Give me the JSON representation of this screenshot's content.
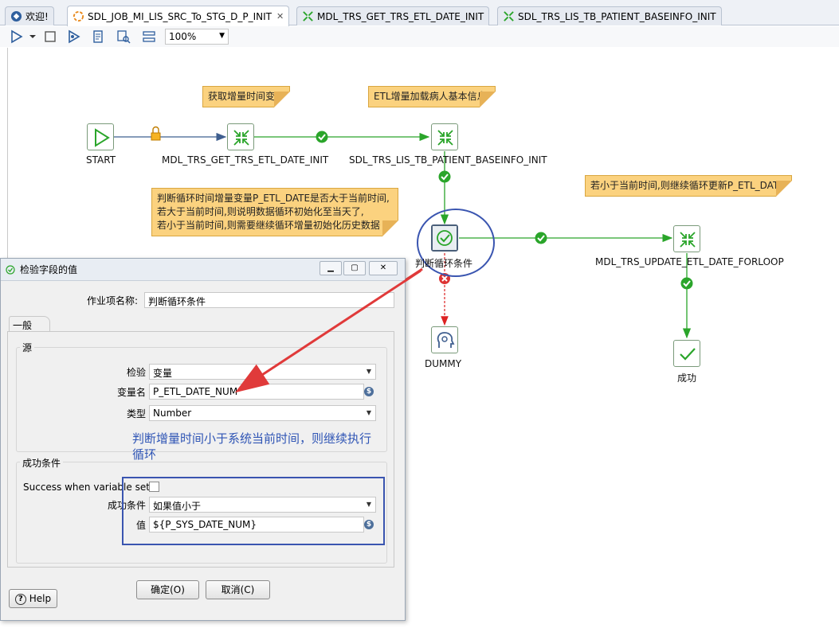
{
  "tabs": [
    {
      "label": "欢迎!",
      "icon": "welcome-icon"
    },
    {
      "label": "SDL_JOB_MI_LIS_SRC_To_STG_D_P_INIT",
      "icon": "job-icon",
      "active": true
    },
    {
      "label": "MDL_TRS_GET_TRS_ETL_DATE_INIT",
      "icon": "transformation-icon"
    },
    {
      "label": "SDL_TRS_LIS_TB_PATIENT_BASEINFO_INIT",
      "icon": "transformation-icon"
    }
  ],
  "toolbar": {
    "zoom": "100%"
  },
  "canvas": {
    "nodes": {
      "start": "START",
      "get_date": "MDL_TRS_GET_TRS_ETL_DATE_INIT",
      "patient": "SDL_TRS_LIS_TB_PATIENT_BASEINFO_INIT",
      "check": "判断循环条件",
      "update": "MDL_TRS_UPDATE_ETL_DATE_FORLOOP",
      "dummy": "DUMMY",
      "success": "成功"
    },
    "notes": {
      "get_date": "获取增量时间变量",
      "patient": "ETL增量加载病人基本信息",
      "check_lines": [
        "判断循环时间增量变量P_ETL_DATE是否大于当前时间,",
        "若大于当前时间,则说明数据循环初始化至当天了,",
        "若小于当前时间,则需要继续循环增量初始化历史数据"
      ],
      "loop": "若小于当前时间,则继续循环更新P_ETL_DATE"
    },
    "annotation_lines": [
      "判断增量时间小于系统当前时间，则继续执行",
      "循环"
    ]
  },
  "dialog": {
    "title": "检验字段的值",
    "job_name_label": "作业项名称:",
    "job_name_value": "判断循环条件",
    "tab_general": "一般",
    "source_group": "源",
    "check_label": "检验",
    "check_value": "变量",
    "var_name_label": "变量名",
    "var_name_value": "P_ETL_DATE_NUM",
    "type_label": "类型",
    "type_value": "Number",
    "success_group": "成功条件",
    "success_var_label": "Success when variable set",
    "condition_label": "成功条件",
    "condition_value": "如果值小于",
    "value_label": "值",
    "value_value": "${P_SYS_DATE_NUM}",
    "ok_button": "确定(O)",
    "cancel_button": "取消(C)",
    "help_button": "Help"
  },
  "colors": {
    "note": "#fbd27f",
    "hop_green": "#2aa52a",
    "highlight_blue": "#3a55b0",
    "arrow_red": "#e03a3a"
  }
}
